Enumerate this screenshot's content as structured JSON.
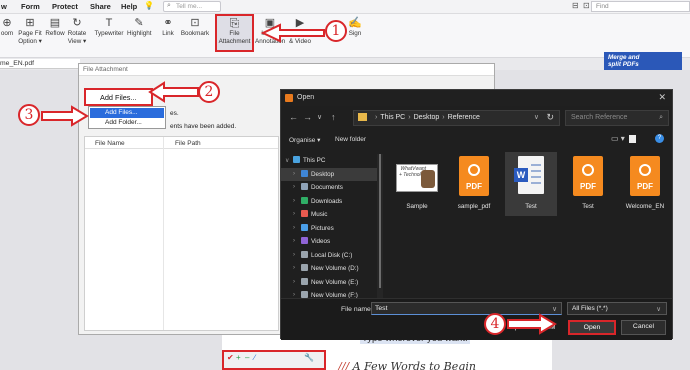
{
  "editor": {
    "menu": [
      "w",
      "Form",
      "Protect",
      "Share",
      "Help"
    ],
    "tell_me": "Tell me...",
    "find_placeholder": "Find",
    "tools": [
      {
        "label": "oom",
        "icon": "zoom-icon"
      },
      {
        "label": "Page Fit\nOption",
        "icon": "page-fit-icon"
      },
      {
        "label": "Reflow",
        "icon": "reflow-icon"
      },
      {
        "label": "Rotate\nView",
        "icon": "rotate-view-icon"
      },
      {
        "label": "Typewriter",
        "icon": "typewriter-icon"
      },
      {
        "label": "Highlight",
        "icon": "highlight-icon"
      },
      {
        "label": "Link",
        "icon": "link-icon"
      },
      {
        "label": "Bookmark",
        "icon": "bookmark-icon"
      },
      {
        "label": "File\nAttachment",
        "icon": "paperclip-icon"
      },
      {
        "label": "Image\nAnnotation",
        "icon": "image-annotation-icon"
      },
      {
        "label": "Audio\n& Video",
        "icon": "audio-video-icon"
      },
      {
        "label": "Sign",
        "icon": "sign-icon"
      }
    ],
    "ad_text": "Merge and\nsplit PDFs",
    "tab": "me_EN.pdf",
    "doc_line1": "Type wherever you want.",
    "doc_line2_prefix": "///",
    "doc_line2": "A  Few Words to Begin"
  },
  "file_attachment": {
    "title": "File Attachment",
    "add_files_button": "Add Files...",
    "menu_items": [
      "Add Files...",
      "Add Folder..."
    ],
    "note1": "es.",
    "note2": "ents have been added.",
    "columns": [
      "File Name",
      "File Path"
    ]
  },
  "open_dialog": {
    "title": "Open",
    "path": [
      "This PC",
      "Desktop",
      "Reference"
    ],
    "search_placeholder": "Search Reference",
    "organise": "Organise ▾",
    "new_folder": "New folder",
    "tree": [
      {
        "label": "This PC",
        "icon": "pc-icon",
        "color": "#4aa3df",
        "expanded": true
      },
      {
        "label": "Desktop",
        "icon": "desktop-icon",
        "color": "#3f86d6",
        "selected": true
      },
      {
        "label": "Documents",
        "icon": "documents-icon",
        "color": "#8fa3b8"
      },
      {
        "label": "Downloads",
        "icon": "downloads-icon",
        "color": "#2fae66"
      },
      {
        "label": "Music",
        "icon": "music-icon",
        "color": "#e85a4f"
      },
      {
        "label": "Pictures",
        "icon": "pictures-icon",
        "color": "#4a9ee8"
      },
      {
        "label": "Videos",
        "icon": "videos-icon",
        "color": "#8f64d6"
      },
      {
        "label": "Local Disk (C:)",
        "icon": "disk-icon",
        "color": "#9aa4ad"
      },
      {
        "label": "New Volume (D:)",
        "icon": "disk-icon",
        "color": "#9aa4ad"
      },
      {
        "label": "New Volume (E:)",
        "icon": "disk-icon",
        "color": "#9aa4ad"
      },
      {
        "label": "New Volume (F:)",
        "icon": "disk-icon",
        "color": "#9aa4ad"
      }
    ],
    "files": [
      {
        "name": "Sample",
        "type": "image"
      },
      {
        "name": "sample_pdf",
        "type": "pdf"
      },
      {
        "name": "Test",
        "type": "word",
        "selected": true
      },
      {
        "name": "Test",
        "type": "pdf"
      },
      {
        "name": "Welcome_EN",
        "type": "pdf"
      }
    ],
    "sample_thumb_text": "WhatVwant\n+ Technolo...",
    "pdf_label": "PDF",
    "word_label": "W",
    "file_name_label": "File name:",
    "file_name_value": "Test",
    "filter_value": "All Files (*.*)",
    "open_from_ecm": "Open from ECM",
    "open_button": "Open",
    "cancel_button": "Cancel"
  },
  "annotations": {
    "callouts": [
      "1",
      "2",
      "3",
      "4"
    ],
    "color": "#d9262a"
  }
}
